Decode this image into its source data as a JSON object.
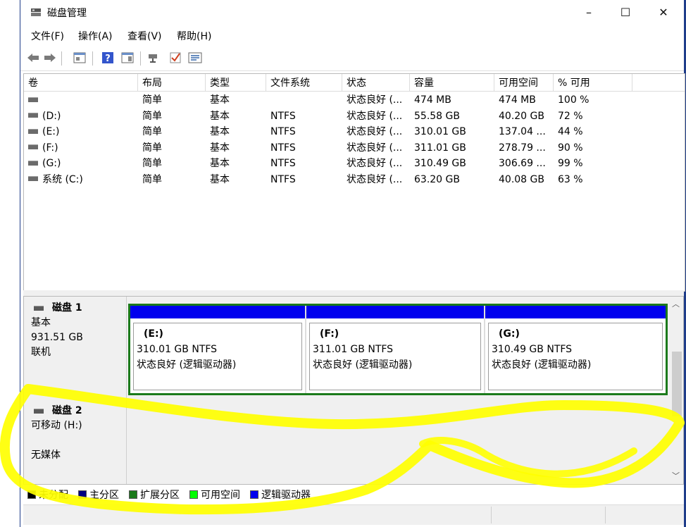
{
  "window": {
    "title": "磁盘管理",
    "controls": [
      "–",
      "☐",
      "✕"
    ]
  },
  "menu": [
    "文件(F)",
    "操作(A)",
    "查看(V)",
    "帮助(H)"
  ],
  "toolbar": {
    "icons": [
      "back-icon",
      "forward-icon",
      "view-icon",
      "help-icon",
      "properties-icon",
      "connect-icon",
      "check-icon",
      "list-icon"
    ]
  },
  "volumes": {
    "headers": [
      "卷",
      "布局",
      "类型",
      "文件系统",
      "状态",
      "容量",
      "可用空间",
      "% 可用"
    ],
    "rows": [
      [
        "",
        "简单",
        "基本",
        "",
        "状态良好 (...",
        "474 MB",
        "474 MB",
        "100 %"
      ],
      [
        "(D:)",
        "简单",
        "基本",
        "NTFS",
        "状态良好 (...",
        "55.58 GB",
        "40.20 GB",
        "72 %"
      ],
      [
        "(E:)",
        "简单",
        "基本",
        "NTFS",
        "状态良好 (...",
        "310.01 GB",
        "137.04 ...",
        "44 %"
      ],
      [
        "(F:)",
        "简单",
        "基本",
        "NTFS",
        "状态良好 (...",
        "311.01 GB",
        "278.79 ...",
        "90 %"
      ],
      [
        "(G:)",
        "简单",
        "基本",
        "NTFS",
        "状态良好 (...",
        "310.49 GB",
        "306.69 ...",
        "99 %"
      ],
      [
        "系统 (C:)",
        "简单",
        "基本",
        "NTFS",
        "状态良好 (...",
        "63.20 GB",
        "40.08 GB",
        "63 %"
      ]
    ]
  },
  "disk1": {
    "name": "磁盘 1",
    "type": "基本",
    "size": "931.51 GB",
    "status": "联机",
    "partitions": [
      {
        "name": "(E:)",
        "size": "310.01 GB NTFS",
        "status": "状态良好 (逻辑驱动器)"
      },
      {
        "name": "(F:)",
        "size": "311.01 GB NTFS",
        "status": "状态良好 (逻辑驱动器)"
      },
      {
        "name": "(G:)",
        "size": "310.49 GB NTFS",
        "status": "状态良好 (逻辑驱动器)"
      }
    ]
  },
  "disk2": {
    "name": "磁盘 2",
    "type": "可移动 (H:)",
    "media": "无媒体"
  },
  "legend": [
    {
      "label": "未分配",
      "color": "#000000"
    },
    {
      "label": "主分区",
      "color": "#000080"
    },
    {
      "label": "扩展分区",
      "color": "#1b7a1b"
    },
    {
      "label": "可用空间",
      "color": "#00ff00"
    },
    {
      "label": "逻辑驱动器",
      "color": "#0000ee"
    }
  ],
  "colors": {
    "logical_bar": "#0000ee",
    "extended_border": "#1b7a1b",
    "annotation": "#ffff00"
  }
}
